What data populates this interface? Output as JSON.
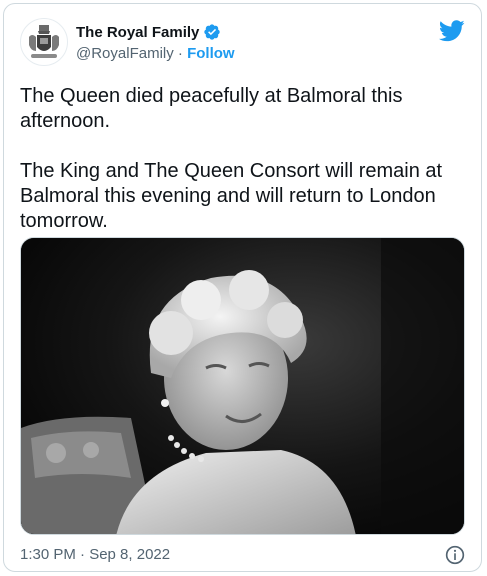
{
  "author": {
    "display_name": "The Royal Family",
    "handle": "@RoyalFamily",
    "separator": "·",
    "follow_label": "Follow",
    "verified": true
  },
  "tweet": {
    "text": "The Queen died peacefully at Balmoral this afternoon.\n\nThe King and The Queen Consort will remain at Balmoral this evening and will return to London tomorrow.",
    "timestamp": "1:30 PM · Sep 8, 2022"
  },
  "media": {
    "kind": "black-and-white portrait photo"
  },
  "icons": {
    "brand": "twitter-bird-icon",
    "verified": "verified-badge-icon",
    "info": "info-icon",
    "avatar": "royal-coat-of-arms"
  },
  "colors": {
    "accent": "#1d9bf0",
    "text": "#0f1419",
    "muted": "#536471",
    "border": "#cfd9de"
  }
}
